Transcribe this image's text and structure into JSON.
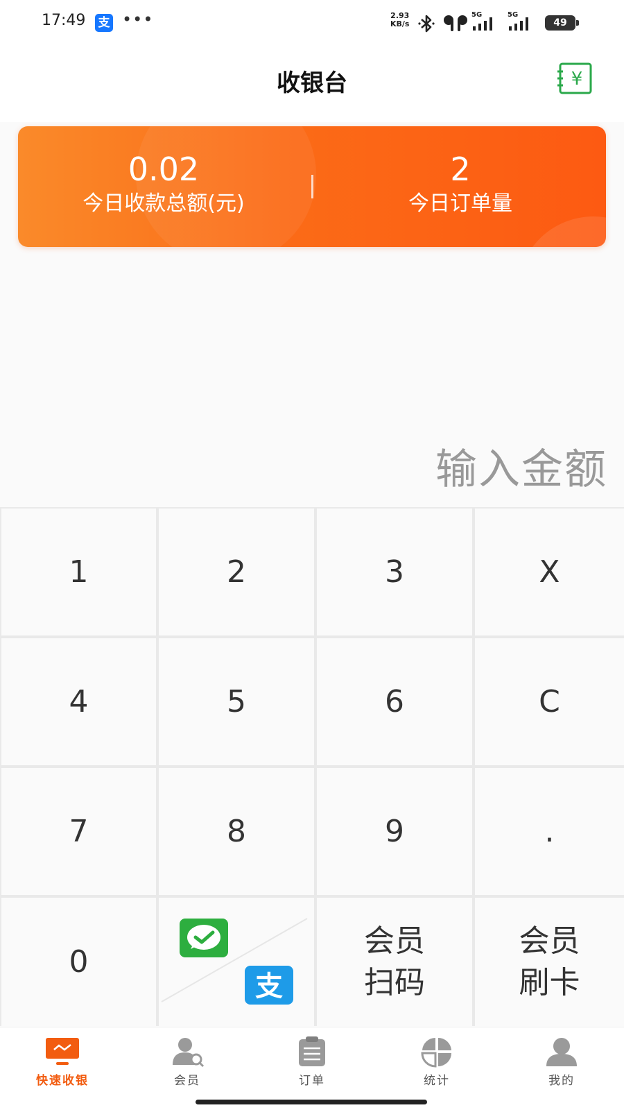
{
  "status_bar": {
    "time": "17:49",
    "alipay_glyph": "支",
    "dots": "•••",
    "net_speed_value": "2.93",
    "net_speed_unit": "KB/s",
    "signal_1_label": "5G",
    "signal_2_label": "5G",
    "battery": "49",
    "icons": [
      "alipay-icon",
      "bluetooth-icon",
      "earbuds-icon",
      "signal-icon",
      "battery-icon"
    ]
  },
  "header": {
    "title": "收银台",
    "action_icon": "cashier-yuan-icon"
  },
  "summary": {
    "total_amount": "0.02",
    "total_amount_label": "今日收款总额(元)",
    "order_count": "2",
    "order_count_label": "今日订单量",
    "gradient_start": "#fa8a2a",
    "gradient_end": "#fd5a12"
  },
  "amount_input": {
    "placeholder": "输入金额"
  },
  "keypad": {
    "keys": [
      "1",
      "2",
      "3",
      "X",
      "4",
      "5",
      "6",
      "C",
      "7",
      "8",
      "9",
      ".",
      "0"
    ],
    "pay_icons": [
      "wechat-pay-icon",
      "alipay-icon"
    ],
    "member_scan": [
      "会员",
      "扫码"
    ],
    "member_card": [
      "会员",
      "刷卡"
    ]
  },
  "bottom_nav": {
    "items": [
      {
        "label": "快速收银",
        "icon": "monitor-icon",
        "active": true
      },
      {
        "label": "会员",
        "icon": "member-icon",
        "active": false
      },
      {
        "label": "订单",
        "icon": "clipboard-icon",
        "active": false
      },
      {
        "label": "统计",
        "icon": "stats-icon",
        "active": false
      },
      {
        "label": "我的",
        "icon": "profile-icon",
        "active": false
      }
    ],
    "active_color": "#f25c10"
  }
}
